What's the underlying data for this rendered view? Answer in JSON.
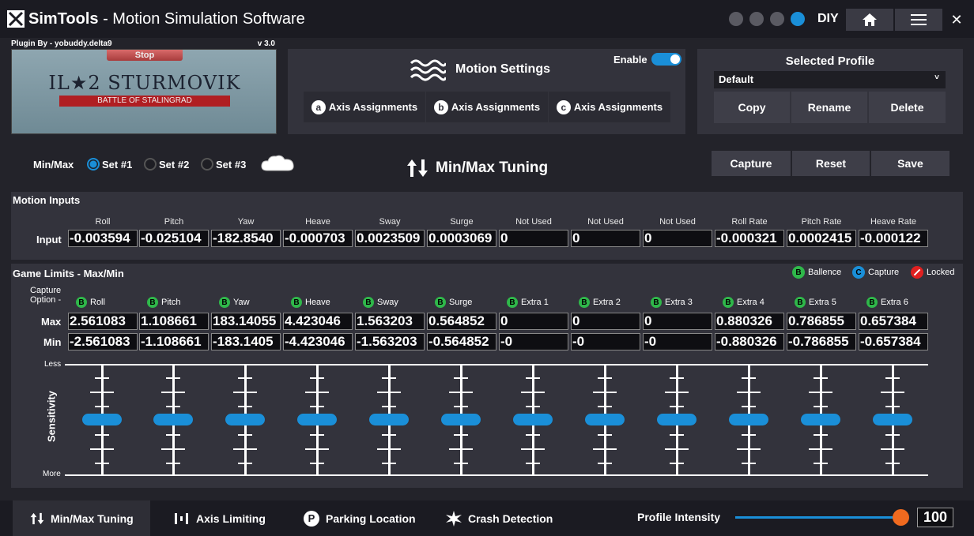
{
  "app": {
    "brand": "SimTools",
    "title_rest": " - Motion Simulation Software",
    "diy": "DIY"
  },
  "plugin": {
    "author": "Plugin By - yobuddy.delta9",
    "version": "v 3.0",
    "stop": "Stop",
    "game_title": "IL★2 STURMOVIK",
    "game_subtitle": "BATTLE OF STALINGRAD"
  },
  "motion_settings": {
    "title": "Motion Settings",
    "enable_label": "Enable",
    "axis_buttons": [
      {
        "letter": "a",
        "label": "Axis Assignments"
      },
      {
        "letter": "b",
        "label": "Axis Assignments"
      },
      {
        "letter": "c",
        "label": "Axis Assignments"
      }
    ]
  },
  "profile": {
    "title": "Selected Profile",
    "selected": "Default",
    "copy": "Copy",
    "rename": "Rename",
    "delete": "Delete"
  },
  "minmax": {
    "label": "Min/Max",
    "sets": [
      "Set #1",
      "Set #2",
      "Set #3"
    ],
    "title": "Min/Max Tuning",
    "capture": "Capture",
    "reset": "Reset",
    "save": "Save"
  },
  "motion_inputs": {
    "title": "Motion Inputs",
    "row_label": "Input",
    "columns": [
      "Roll",
      "Pitch",
      "Yaw",
      "Heave",
      "Sway",
      "Surge",
      "Not Used",
      "Not Used",
      "Not Used",
      "Roll Rate",
      "Pitch Rate",
      "Heave Rate"
    ],
    "values": [
      "-0.003594",
      "-0.025104",
      "-182.8540",
      "-0.000703",
      "0.0023509",
      "0.0003069",
      "0",
      "0",
      "0",
      "-0.000321",
      "0.0002415",
      "-0.000122"
    ]
  },
  "game_limits": {
    "title": "Game Limits - Max/Min",
    "capture_option": "Capture Option -",
    "legend": [
      {
        "letter": "B",
        "label": "Ballence",
        "color": "#2fb84a"
      },
      {
        "letter": "C",
        "label": "Capture",
        "color": "#1a8fd8"
      },
      {
        "letter": "",
        "label": "Locked",
        "color": "#e02020"
      }
    ],
    "columns": [
      "Roll",
      "Pitch",
      "Yaw",
      "Heave",
      "Sway",
      "Surge",
      "Extra 1",
      "Extra 2",
      "Extra 3",
      "Extra 4",
      "Extra 5",
      "Extra 6"
    ],
    "badge_letter": "B",
    "max_label": "Max",
    "min_label": "Min",
    "max": [
      "2.561083",
      "1.108661",
      "183.14055",
      "4.423046",
      "1.563203",
      "0.564852",
      "0",
      "0",
      "0",
      "0.880326",
      "0.786855",
      "0.657384"
    ],
    "min": [
      "-2.561083",
      "-1.108661",
      "-183.1405",
      "-4.423046",
      "-1.563203",
      "-0.564852",
      "-0",
      "-0",
      "-0",
      "-0.880326",
      "-0.786855",
      "-0.657384"
    ],
    "sensitivity_label": "Sensitivity",
    "less": "Less",
    "more": "More"
  },
  "bottom": {
    "tabs": [
      "Min/Max Tuning",
      "Axis Limiting",
      "Parking Location",
      "Crash Detection"
    ],
    "intensity_label": "Profile Intensity",
    "intensity_value": "100"
  },
  "colors": {
    "accent": "#1a8fd8",
    "slider_knob": "#f06a1f"
  }
}
